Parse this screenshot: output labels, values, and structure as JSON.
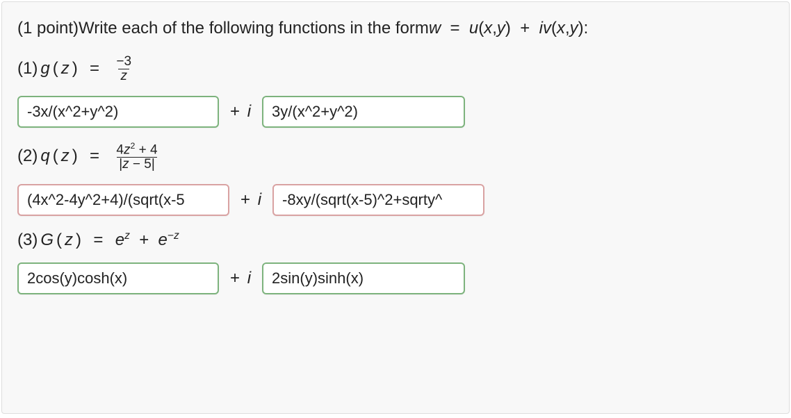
{
  "prompt": {
    "points_prefix": "(1 point) ",
    "text_before": "Write each of the following functions in the form ",
    "w": "w",
    "equals": "  =  ",
    "u": "u",
    "open": "(",
    "x": "x",
    "comma": ", ",
    "y": "y",
    "close": ")",
    "plus": "  +  ",
    "i": "i",
    "v": "v",
    "colon": " :"
  },
  "parts": [
    {
      "label_num": "(1) ",
      "fn_name": "g",
      "arg": "z",
      "equals": "  =  ",
      "frac_num": "−3",
      "frac_den": "z",
      "ans_u": "-3x/(x^2+y^2)",
      "ans_v": "3y/(x^2+y^2)",
      "status_u": "correct",
      "status_v": "correct"
    },
    {
      "label_num": "(2) ",
      "fn_name": "q",
      "arg": "z",
      "equals": "  =  ",
      "frac_num_html": "4z² + 4",
      "frac_den_html": "|z − 5|",
      "ans_u": "(4x^2-4y^2+4)/(sqrt(x-5",
      "ans_v": "-8xy/(sqrt(x-5)^2+sqrty^",
      "status_u": "incorrect",
      "status_v": "incorrect"
    },
    {
      "label_num": "(3) ",
      "fn_name": "G",
      "arg": "z",
      "equals": "  =  ",
      "rhs_plain": "eᶻ  +  e⁻ᶻ",
      "ans_u": "2cos(y)cosh(x)",
      "ans_v": "2sin(y)sinh(x)",
      "status_u": "correct",
      "status_v": "correct"
    }
  ],
  "plus_i": {
    "plus": "+ ",
    "i": "i"
  }
}
